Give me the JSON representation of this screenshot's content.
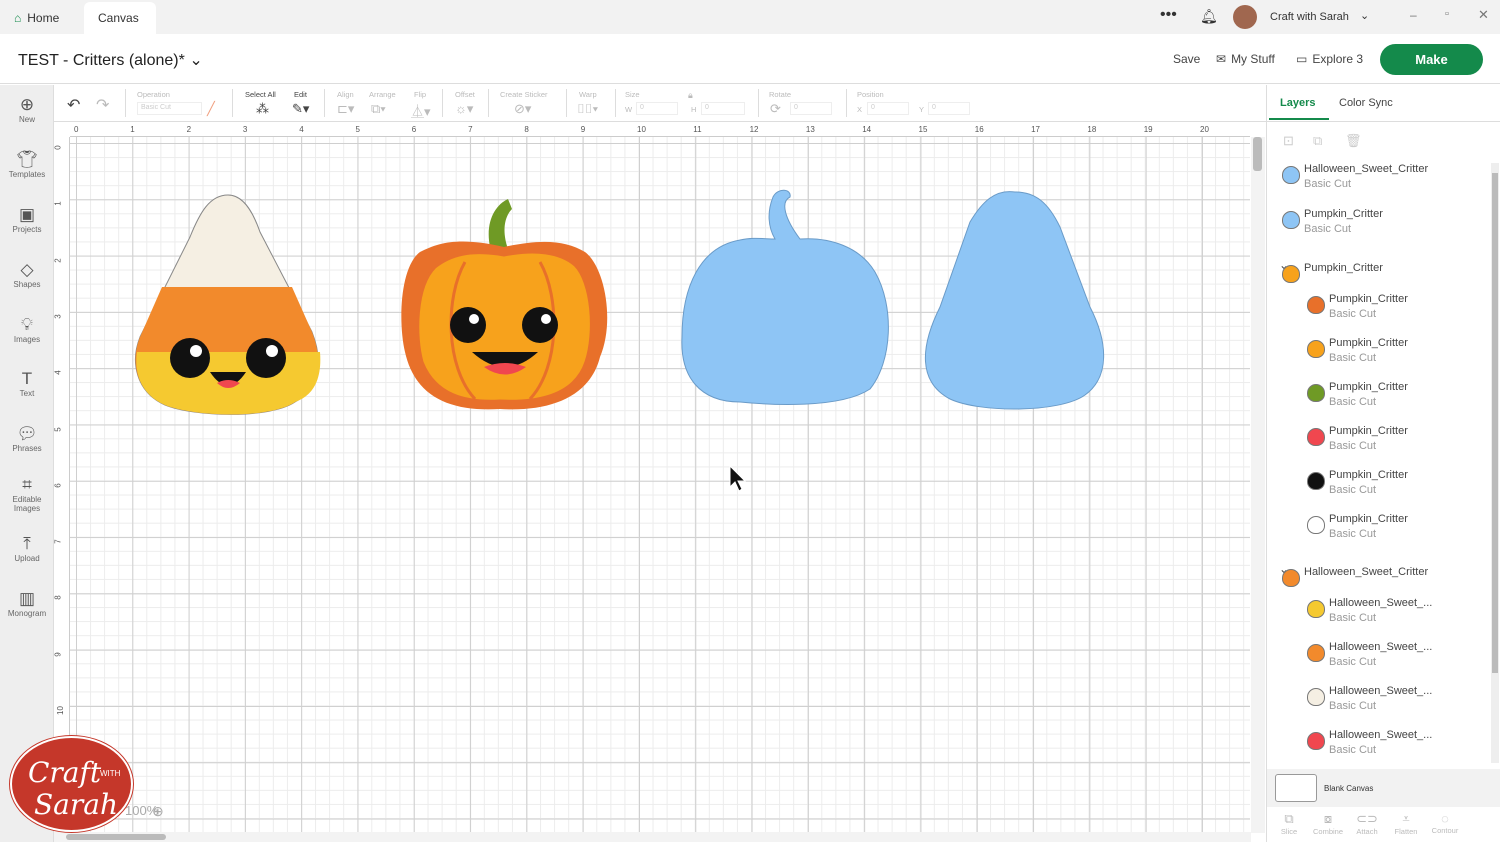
{
  "tabs": [
    {
      "label": "Home",
      "icon": "home-icon"
    },
    {
      "label": "Canvas"
    }
  ],
  "user": {
    "name": "Craft with Sarah"
  },
  "project": {
    "title": "TEST - Critters (alone)*"
  },
  "header": {
    "save": "Save",
    "my_stuff": "My Stuff",
    "machine": "Explore 3",
    "make": "Make"
  },
  "sidebar": [
    {
      "label": "New"
    },
    {
      "label": "Templates"
    },
    {
      "label": "Projects"
    },
    {
      "label": "Shapes"
    },
    {
      "label": "Images"
    },
    {
      "label": "Text"
    },
    {
      "label": "Phrases"
    },
    {
      "label": "Editable Images"
    },
    {
      "label": "Upload"
    },
    {
      "label": "Monogram"
    }
  ],
  "toolbar": {
    "operation": "Operation",
    "operation_value": "Basic Cut",
    "select_all": "Select All",
    "edit": "Edit",
    "align": "Align",
    "arrange": "Arrange",
    "flip": "Flip",
    "offset": "Offset",
    "create_sticker": "Create Sticker",
    "warp": "Warp",
    "size": "Size",
    "w": "W",
    "h": "H",
    "w_value": "0",
    "h_value": "0",
    "rotate": "Rotate",
    "rotate_value": "0",
    "position": "Position",
    "x": "X",
    "y": "Y",
    "x_value": "0",
    "y_value": "0"
  },
  "ruler": {
    "h": [
      "0",
      "1",
      "2",
      "3",
      "4",
      "5",
      "6",
      "7",
      "8",
      "9",
      "10",
      "11",
      "12",
      "13",
      "14",
      "15",
      "16",
      "17",
      "18",
      "19",
      "20"
    ],
    "v": [
      "0",
      "1",
      "2",
      "3",
      "4",
      "5",
      "6",
      "7",
      "8",
      "9",
      "10"
    ]
  },
  "zoom": {
    "value": "100%"
  },
  "panel": {
    "tabs": [
      "Layers",
      "Color Sync"
    ],
    "layers": [
      {
        "name": "Halloween_Sweet_Critter",
        "sub": "Basic Cut",
        "color": "#8ec5f5",
        "indent": 0
      },
      {
        "name": "Pumpkin_Critter",
        "sub": "Basic Cut",
        "color": "#8ec5f5",
        "indent": 0
      },
      {
        "name": "Pumpkin_Critter",
        "sub": "",
        "color": "#f7a21c",
        "indent": 0,
        "group": true
      },
      {
        "name": "Pumpkin_Critter",
        "sub": "Basic Cut",
        "color": "#e8702a",
        "indent": 1
      },
      {
        "name": "Pumpkin_Critter",
        "sub": "Basic Cut",
        "color": "#f7a21c",
        "indent": 1
      },
      {
        "name": "Pumpkin_Critter",
        "sub": "Basic Cut",
        "color": "#6f9a25",
        "indent": 1
      },
      {
        "name": "Pumpkin_Critter",
        "sub": "Basic Cut",
        "color": "#f0474f",
        "indent": 1
      },
      {
        "name": "Pumpkin_Critter",
        "sub": "Basic Cut",
        "color": "#111111",
        "indent": 1
      },
      {
        "name": "Pumpkin_Critter",
        "sub": "Basic Cut",
        "color": "#ffffff",
        "indent": 1
      },
      {
        "name": "Halloween_Sweet_Critter",
        "sub": "",
        "color": "#f28a2c",
        "indent": 0,
        "group": true
      },
      {
        "name": "Halloween_Sweet_...",
        "sub": "Basic Cut",
        "color": "#f5c930",
        "indent": 1
      },
      {
        "name": "Halloween_Sweet_...",
        "sub": "Basic Cut",
        "color": "#f28a2c",
        "indent": 1
      },
      {
        "name": "Halloween_Sweet_...",
        "sub": "Basic Cut",
        "color": "#f5efe3",
        "indent": 1
      },
      {
        "name": "Halloween_Sweet_...",
        "sub": "Basic Cut",
        "color": "#f0474f",
        "indent": 1
      }
    ],
    "blank_canvas": "Blank Canvas",
    "actions": [
      "Slice",
      "Combine",
      "Attach",
      "Flatten",
      "Contour"
    ]
  },
  "logo": {
    "text": "Craft with Sarah"
  }
}
